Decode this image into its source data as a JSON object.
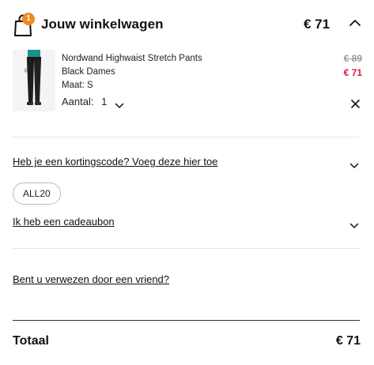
{
  "header": {
    "title": "Jouw winkelwagen",
    "total": "€ 71",
    "badge_count": "1"
  },
  "item": {
    "name": "Nordwand Highwaist Stretch Pants",
    "subtitle": "Black Dames",
    "size": "Maat: S",
    "price_original": "€ 89",
    "price_current": "€ 71",
    "quantity_label": "Aantal:",
    "quantity_value": "1"
  },
  "discount": {
    "link_text": "Heb je een kortingscode? Voeg deze hier toe",
    "applied_code": "ALL20"
  },
  "giftcard": {
    "link_text": "Ik heb een cadeaubon"
  },
  "referral": {
    "link_text": "Bent u verwezen door een vriend?"
  },
  "summary": {
    "total_label": "Totaal",
    "total_value": "€ 71"
  },
  "colors": {
    "badge": "#f08a24",
    "sale_price": "#e0173d",
    "old_price": "#9a9a9a"
  },
  "icons": [
    "shopping-bag-icon",
    "chevron-up-icon",
    "chevron-down-icon",
    "close-icon"
  ]
}
